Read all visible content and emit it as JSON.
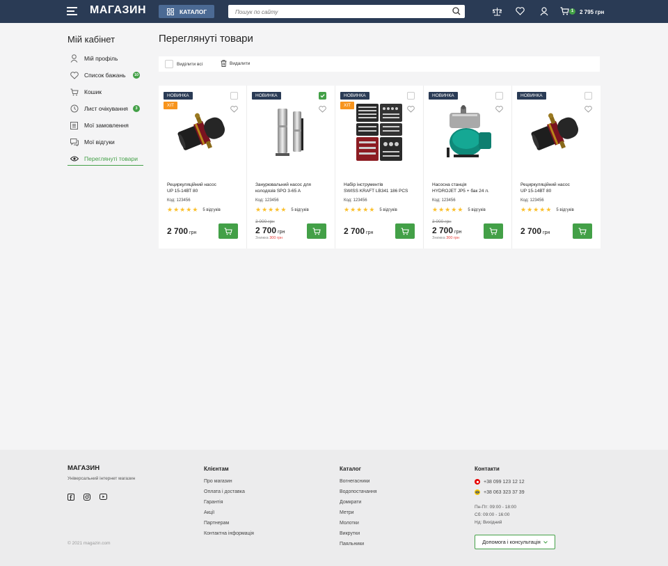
{
  "header": {
    "logo": "МАГАЗИН",
    "catalog_label": "КАТАЛОГ",
    "search_placeholder": "Пошук по сайту",
    "cart_count": "1",
    "cart_total": "2 795 грн"
  },
  "sidebar": {
    "title": "Мій кабінет",
    "items": [
      {
        "label": "Мій профіль",
        "icon": "user-icon"
      },
      {
        "label": "Список бажань",
        "icon": "heart-icon",
        "badge": "10"
      },
      {
        "label": "Кошик",
        "icon": "cart-icon"
      },
      {
        "label": "Лист очікування",
        "icon": "clock-icon",
        "badge": "3"
      },
      {
        "label": "Мої замовлення",
        "icon": "orders-icon"
      },
      {
        "label": "Мої відгуки",
        "icon": "reviews-icon"
      },
      {
        "label": "Переглянуті товари",
        "icon": "eye-icon",
        "active": true
      }
    ]
  },
  "main": {
    "title": "Переглянуті товари",
    "toolbar": {
      "select_all": "Виділити всі",
      "delete": "Видалити"
    },
    "products": [
      {
        "badge_new": "НОВИНКА",
        "badge_hit": "ХІТ",
        "checked": false,
        "name_line1": "Рециркуляційний насос",
        "name_line2": "UP 15-14ВТ 80",
        "code": "Код: 123456",
        "rating": 5,
        "reviews": "5 відгуків",
        "old_price": "",
        "price": "2 700",
        "currency": "грн",
        "discount_label": "",
        "discount_value": "",
        "image": "pump-icon"
      },
      {
        "badge_new": "НОВИНКА",
        "badge_hit": "",
        "checked": true,
        "name_line1": "Занурювальний насос для",
        "name_line2": "колодязів SPO 3-65 A",
        "code": "Код: 123456",
        "rating": 5,
        "reviews": "5 відгуків",
        "old_price": "3 000 грн",
        "price": "2 700",
        "currency": "грн",
        "discount_label": "Знижка",
        "discount_value": "300 грн",
        "image": "borehole-pump-icon"
      },
      {
        "badge_new": "НОВИНКА",
        "badge_hit": "ХІТ",
        "checked": false,
        "name_line1": "Набір інструментів",
        "name_line2": "SWISS KRAFT LB341 186 PCS",
        "code": "Код: 123456",
        "rating": 5,
        "reviews": "5 відгуків",
        "old_price": "",
        "price": "2 700",
        "currency": "грн",
        "discount_label": "",
        "discount_value": "",
        "image": "toolset-icon"
      },
      {
        "badge_new": "НОВИНКА",
        "badge_hit": "",
        "checked": false,
        "name_line1": "Насосна станція",
        "name_line2": "HYDROJET JP5 + бак 24 л.",
        "code": "Код: 123456",
        "rating": 5,
        "reviews": "5 відгуків",
        "old_price": "3 000 грн",
        "price": "2 700",
        "currency": "грн",
        "discount_label": "Знижка",
        "discount_value": "300 грн",
        "image": "pump-station-icon"
      },
      {
        "badge_new": "НОВИНКА",
        "badge_hit": "",
        "checked": false,
        "name_line1": "Рециркуляційний насос",
        "name_line2": "UP 15-14ВТ 80",
        "code": "Код: 123456",
        "rating": 5,
        "reviews": "5 відгуків",
        "old_price": "",
        "price": "2 700",
        "currency": "грн",
        "discount_label": "",
        "discount_value": "",
        "image": "pump-icon"
      }
    ]
  },
  "footer": {
    "logo": "МАГАЗИН",
    "tagline": "Універсальний інтернет магазин",
    "copyright": "© 2021 magazin.com",
    "clients": {
      "title": "Клієнтам",
      "links": [
        "Про магазин",
        "Оплата і доставка",
        "Гарантія",
        "Акції",
        "Партнерам",
        "Контактна інформація"
      ]
    },
    "catalog": {
      "title": "Каталог",
      "links": [
        "Вогнегасники",
        "Водопостачання",
        "Домкрати",
        "Метри",
        "Молотки",
        "Викрутки",
        "Паяльники"
      ]
    },
    "contacts": {
      "title": "Контакти",
      "phones": [
        "+38 099 123 12 12",
        "+38 063 323 37 39"
      ],
      "hours": [
        "Пн-Пт: 09:00 - 18:00",
        "Сб: 09:00 - 16:00",
        "Нд: Вихідний"
      ],
      "help_label": "Допомога і консультація"
    }
  },
  "colors": {
    "header": "#2a3b55",
    "accent": "#43a047",
    "hit": "#f7941d",
    "discount": "#e53935"
  }
}
